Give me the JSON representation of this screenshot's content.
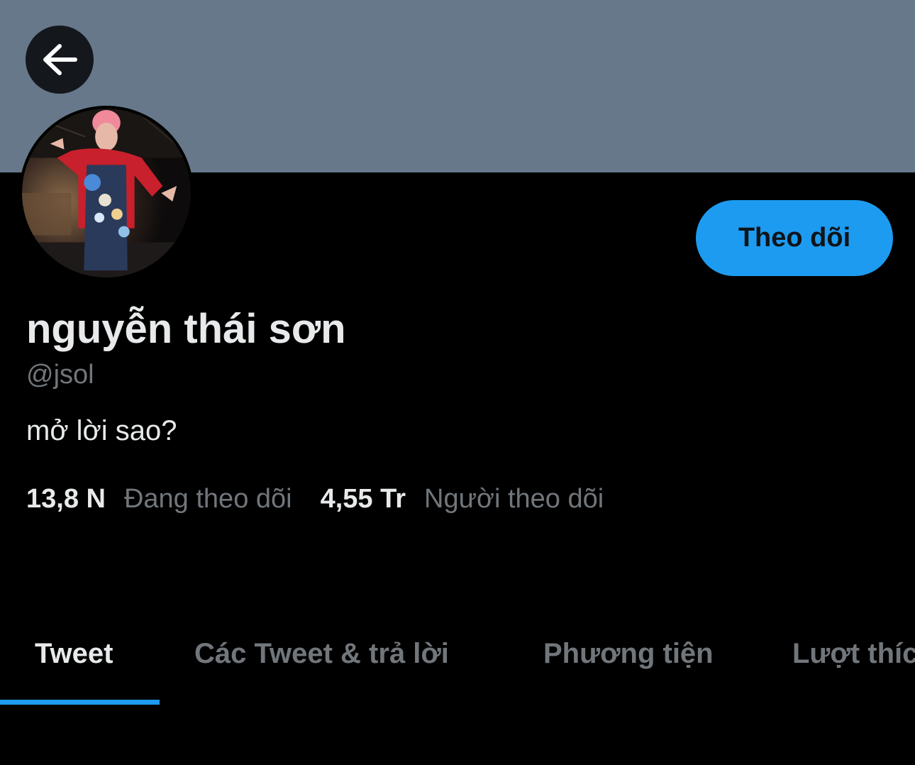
{
  "header": {
    "banner_color": "#66788a",
    "back_icon": "arrow-left-icon"
  },
  "profile": {
    "display_name": "nguyễn thái sơn",
    "handle": "@jsol",
    "bio": "mở lời sao?",
    "follow_label": "Theo dõi",
    "following_count": "13,8 N",
    "following_label": "Đang theo dõi",
    "followers_count": "4,55 Tr",
    "followers_label": "Người theo dõi"
  },
  "tabs": [
    {
      "label": "Tweet",
      "active": true
    },
    {
      "label": "Các Tweet & trả lời",
      "active": false
    },
    {
      "label": "Phương tiện",
      "active": false
    },
    {
      "label": "Lượt thích",
      "active": false
    }
  ],
  "colors": {
    "accent": "#1d9bf0",
    "background": "#000000",
    "primary_text": "#e7e9ea",
    "secondary_text": "#71767b"
  }
}
